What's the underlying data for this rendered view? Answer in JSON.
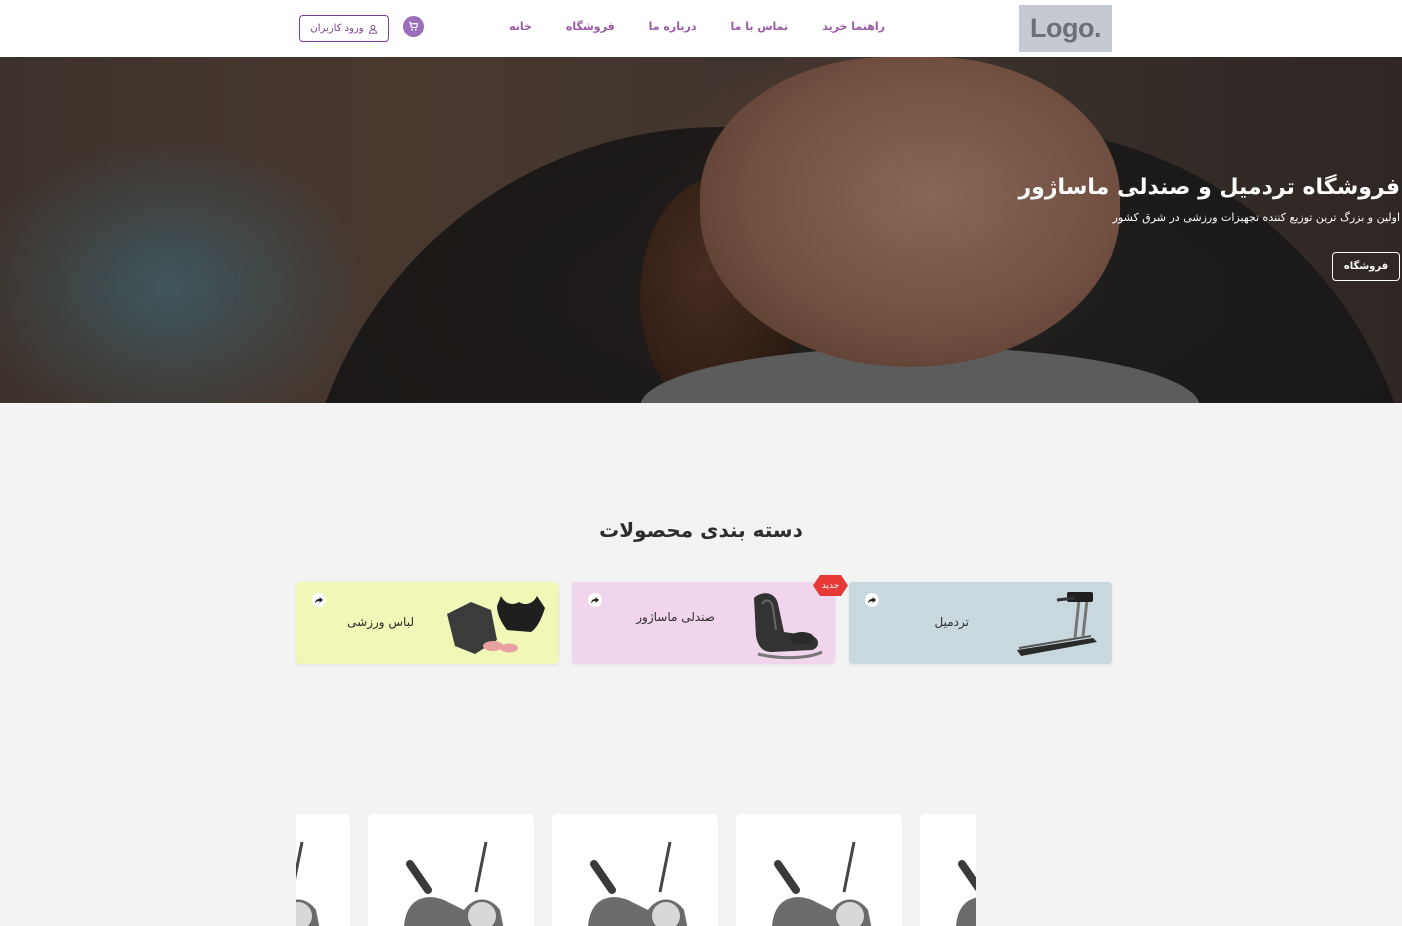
{
  "header": {
    "logo_text": "Logo.",
    "nav": [
      {
        "label": "خانه"
      },
      {
        "label": "فروشگاه"
      },
      {
        "label": "درباره ما"
      },
      {
        "label": "تماس با ما"
      },
      {
        "label": "راهنما خرید"
      }
    ],
    "cart_icon": "cart-icon",
    "login_label": "ورود کاربران",
    "login_icon": "user-icon"
  },
  "hero": {
    "title": "فروشگاه تردمیل و صندلی ماساژور",
    "subtitle": "اولین و بزرگ ترین توزیع کننده تجهیزات ورزشی در شرق کشور",
    "button_label": "فروشگاه"
  },
  "categories": {
    "title": "دسته بندی محصولات",
    "items": [
      {
        "label": "تردمیل",
        "color": "#c9d8df",
        "icon": "treadmill-image"
      },
      {
        "label": "صندلی ماساژور",
        "color": "#f1d5ec",
        "icon": "massage-chair-image",
        "badge": "جدید"
      },
      {
        "label": "لباس ورزشی",
        "color": "#f0f7b7",
        "icon": "sportswear-image"
      }
    ],
    "share_icon": "share-icon"
  },
  "products": {
    "items": [
      {
        "icon": "exercise-bike-image"
      },
      {
        "icon": "exercise-bike-image"
      },
      {
        "icon": "exercise-bike-image"
      },
      {
        "icon": "exercise-bike-image"
      }
    ]
  },
  "colors": {
    "accent": "#9b59a8",
    "login_border": "#7b3f8e",
    "badge": "#e53935"
  }
}
